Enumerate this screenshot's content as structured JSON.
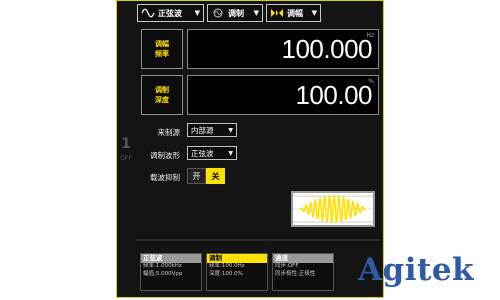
{
  "toolbar": {
    "waveform": {
      "label": "正弦波",
      "icon": "sine-wave-icon"
    },
    "mod": {
      "label": "调制",
      "icon": "modulation-icon"
    },
    "mod_type": {
      "label": "调幅",
      "icon": "am-icon"
    }
  },
  "freq": {
    "label_line1": "调幅",
    "label_line2": "频率",
    "unit": "Hz",
    "value": "100.000"
  },
  "depth": {
    "label_line1": "调制",
    "label_line2": "深度",
    "unit": "%",
    "value": "100.00"
  },
  "source": {
    "label": "来制源",
    "value": "内部源"
  },
  "mod_wave": {
    "label": "调制波形",
    "value": "正弦波"
  },
  "carrier_suppress": {
    "label": "载波抑制",
    "on_label": "开",
    "off_label": "关",
    "selected": "off"
  },
  "channel": {
    "number": "1",
    "state": "OFF"
  },
  "footer": {
    "sine": {
      "title": "正弦波",
      "line1": "频率:1.000kHz",
      "line2": "幅值:5.000Vpp"
    },
    "mod": {
      "title": "调制",
      "line1": "频率:100.0Hz",
      "line2": "深度:100.0%"
    },
    "channel": {
      "title": "通道",
      "line1": "同步:OFF",
      "line2": "同步极性:正极性"
    }
  },
  "watermark": "Agitek",
  "colors": {
    "accent": "#ffe000",
    "border": "#d8d300",
    "watermark": "#2f5aa8"
  }
}
